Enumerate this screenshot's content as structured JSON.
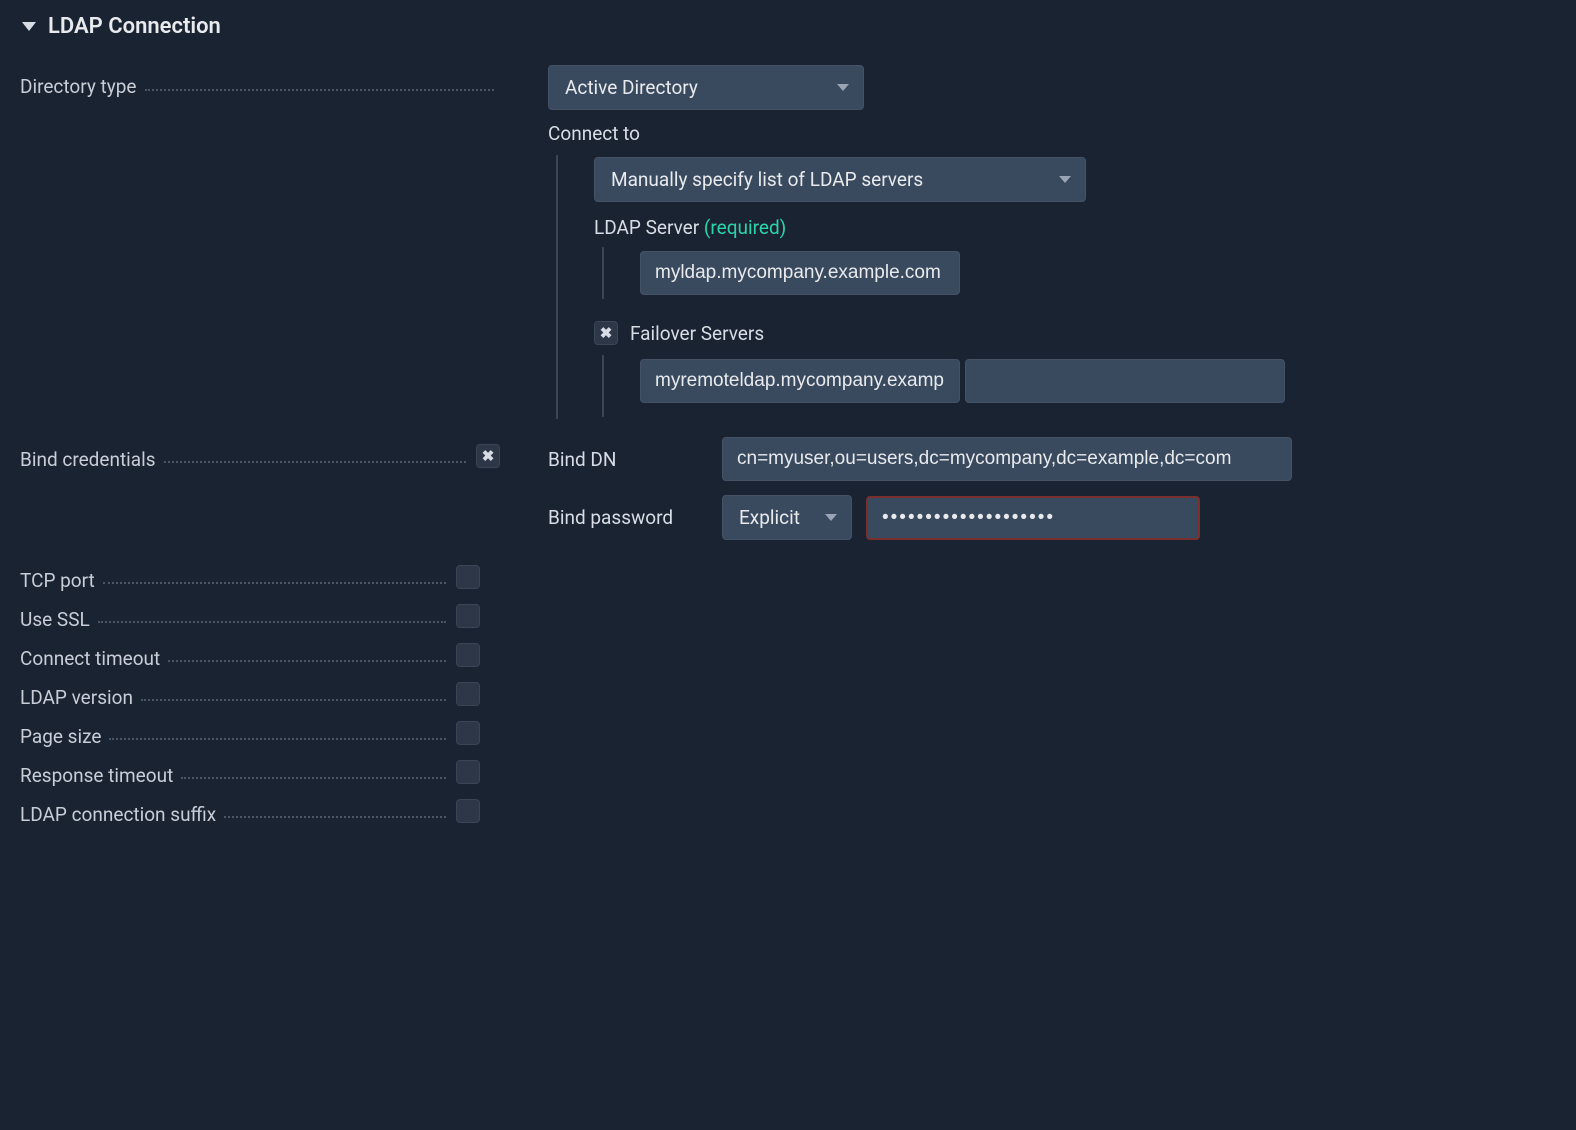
{
  "section": {
    "title": "LDAP Connection"
  },
  "directory_type": {
    "label": "Directory type",
    "value": "Active Directory"
  },
  "connect_to": {
    "label": "Connect to",
    "value": "Manually specify list of LDAP servers"
  },
  "ldap_server": {
    "label": "LDAP Server",
    "required_text": "(required)",
    "value": "myldap.mycompany.example.com"
  },
  "failover": {
    "label": "Failover Servers",
    "servers": [
      "myremoteldap.mycompany.example.com",
      ""
    ]
  },
  "bind_credentials": {
    "label": "Bind credentials",
    "bind_dn_label": "Bind DN",
    "bind_dn_value": "cn=myuser,ou=users,dc=mycompany,dc=example,dc=com",
    "bind_password_label": "Bind password",
    "password_mode": "Explicit",
    "password_value": "••••••••••••••••••••"
  },
  "simple_fields": {
    "tcp_port": "TCP port",
    "use_ssl": "Use SSL",
    "connect_timeout": "Connect timeout",
    "ldap_version": "LDAP version",
    "page_size": "Page size",
    "response_timeout": "Response timeout",
    "ldap_connection_suffix": "LDAP connection suffix"
  }
}
